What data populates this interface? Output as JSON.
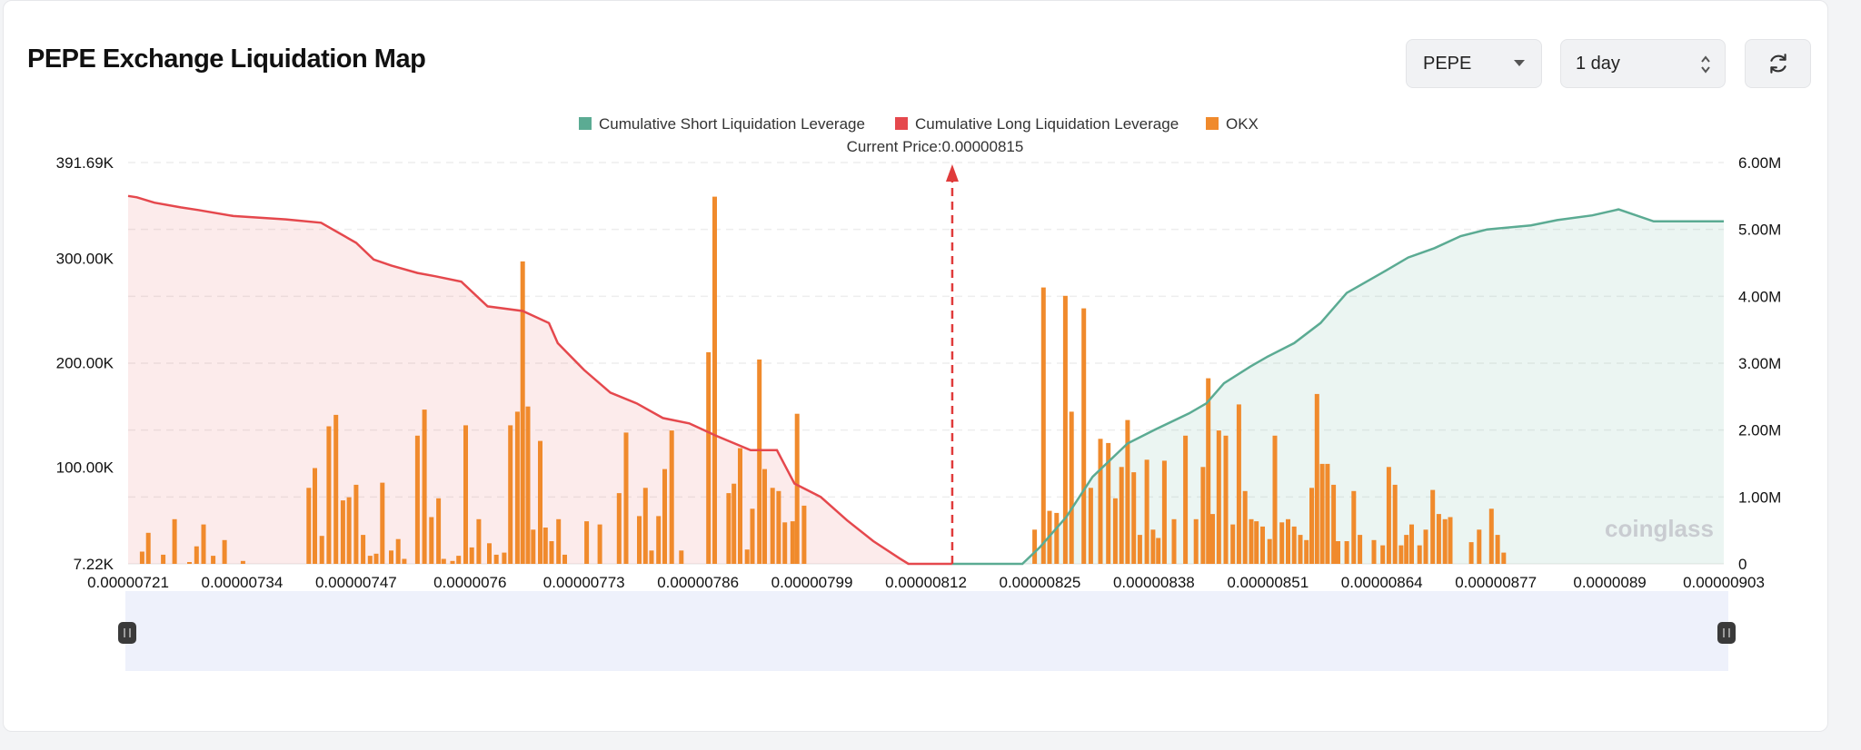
{
  "title": "PEPE Exchange Liquidation Map",
  "controls": {
    "coin": "PEPE",
    "range": "1 day"
  },
  "icons": {
    "dropdown": "caret-down-icon",
    "stepper": "updown-icon",
    "refresh": "refresh-icon"
  },
  "watermark": "coinglass",
  "colors": {
    "short": "#5bab93",
    "long": "#e5484d",
    "okx": "#f08a2c"
  },
  "chart_data": {
    "type": "bar",
    "current_price_label": "Current Price:0.00000815",
    "current_price": 8.15e-06,
    "legend": [
      {
        "name": "Cumulative Short Liquidation Leverage",
        "color": "#5bab93"
      },
      {
        "name": "Cumulative Long Liquidation Leverage",
        "color": "#e5484d"
      },
      {
        "name": "OKX",
        "color": "#f08a2c"
      }
    ],
    "x_ticks": [
      "0.00000721",
      "0.00000734",
      "0.00000747",
      "0.0000076",
      "0.00000773",
      "0.00000786",
      "0.00000799",
      "0.00000812",
      "0.00000825",
      "0.00000838",
      "0.00000851",
      "0.00000864",
      "0.00000877",
      "0.0000089",
      "0.00000903"
    ],
    "x_range": [
      7.21e-06,
      9.03e-06
    ],
    "y_left": {
      "ticks": [
        "7.22K",
        "100.00K",
        "200.00K",
        "300.00K",
        "391.69K"
      ],
      "tick_values": [
        7220,
        100000,
        200000,
        300000,
        391690
      ],
      "range": [
        7220,
        391690
      ]
    },
    "y_right": {
      "ticks": [
        "0",
        "1.00M",
        "2.00M",
        "3.00M",
        "4.00M",
        "5.00M",
        "6.00M"
      ],
      "tick_values": [
        0,
        1000000,
        2000000,
        3000000,
        4000000,
        5000000,
        6000000
      ],
      "range": [
        0,
        6000000
      ]
    },
    "okx_bars": [
      [
        7.226e-06,
        19000
      ],
      [
        7.233e-06,
        37000
      ],
      [
        7.25e-06,
        16000
      ],
      [
        7.263e-06,
        50000
      ],
      [
        7.28e-06,
        9000
      ],
      [
        7.288e-06,
        24000
      ],
      [
        7.296e-06,
        45000
      ],
      [
        7.307e-06,
        15000
      ],
      [
        7.32e-06,
        30000
      ],
      [
        7.341e-06,
        10000
      ],
      [
        7.416e-06,
        80000
      ],
      [
        7.423e-06,
        99000
      ],
      [
        7.431e-06,
        34000
      ],
      [
        7.439e-06,
        139000
      ],
      [
        7.447e-06,
        150000
      ],
      [
        7.455e-06,
        68000
      ],
      [
        7.462e-06,
        71000
      ],
      [
        7.47e-06,
        83000
      ],
      [
        7.478e-06,
        35000
      ],
      [
        7.486e-06,
        15000
      ],
      [
        7.493e-06,
        17000
      ],
      [
        7.5e-06,
        85000
      ],
      [
        7.51e-06,
        20000
      ],
      [
        7.518e-06,
        31000
      ],
      [
        7.525e-06,
        12000
      ],
      [
        7.54e-06,
        130000
      ],
      [
        7.548e-06,
        155000
      ],
      [
        7.556e-06,
        52000
      ],
      [
        7.564e-06,
        70000
      ],
      [
        7.57e-06,
        12000
      ],
      [
        7.58e-06,
        10000
      ],
      [
        7.587e-06,
        15000
      ],
      [
        7.595e-06,
        140000
      ],
      [
        7.602e-06,
        23000
      ],
      [
        7.61e-06,
        50000
      ],
      [
        7.622e-06,
        27000
      ],
      [
        7.63e-06,
        16000
      ],
      [
        7.639e-06,
        18000
      ],
      [
        7.646e-06,
        140000
      ],
      [
        7.654e-06,
        153000
      ],
      [
        7.66e-06,
        297000
      ],
      [
        7.666e-06,
        158000
      ],
      [
        7.672e-06,
        40000
      ],
      [
        7.68e-06,
        125000
      ],
      [
        7.686e-06,
        42000
      ],
      [
        7.693e-06,
        29000
      ],
      [
        7.701e-06,
        50000
      ],
      [
        7.708e-06,
        16000
      ],
      [
        7.733e-06,
        48000
      ],
      [
        7.748e-06,
        45000
      ],
      [
        7.77e-06,
        75000
      ],
      [
        7.778e-06,
        133000
      ],
      [
        7.793e-06,
        53000
      ],
      [
        7.8e-06,
        80000
      ],
      [
        7.807e-06,
        20000
      ],
      [
        7.815e-06,
        53000
      ],
      [
        7.822e-06,
        98000
      ],
      [
        7.83e-06,
        135000
      ],
      [
        7.841e-06,
        20000
      ],
      [
        7.872e-06,
        210000
      ],
      [
        7.879e-06,
        359000
      ],
      [
        7.895e-06,
        75000
      ],
      [
        7.901e-06,
        84000
      ],
      [
        7.908e-06,
        118000
      ],
      [
        7.916e-06,
        21000
      ],
      [
        7.922e-06,
        60000
      ],
      [
        7.93e-06,
        203000
      ],
      [
        7.936e-06,
        98000
      ],
      [
        7.945e-06,
        80000
      ],
      [
        7.952e-06,
        77000
      ],
      [
        7.959e-06,
        47000
      ],
      [
        7.968e-06,
        48000
      ],
      [
        7.973e-06,
        151000
      ],
      [
        7.981e-06,
        63000
      ],
      [
        8.244e-06,
        40000
      ],
      [
        8.254e-06,
        272000
      ],
      [
        8.261e-06,
        58000
      ],
      [
        8.269e-06,
        56000
      ],
      [
        8.279e-06,
        264000
      ],
      [
        8.286e-06,
        153000
      ],
      [
        8.3e-06,
        252000
      ],
      [
        8.308e-06,
        80000
      ],
      [
        8.319e-06,
        127000
      ],
      [
        8.328e-06,
        123000
      ],
      [
        8.336e-06,
        70000
      ],
      [
        8.343e-06,
        100000
      ],
      [
        8.35e-06,
        145000
      ],
      [
        8.357e-06,
        95000
      ],
      [
        8.364e-06,
        35000
      ],
      [
        8.372e-06,
        107000
      ],
      [
        8.379e-06,
        40000
      ],
      [
        8.385e-06,
        32000
      ],
      [
        8.392e-06,
        106000
      ],
      [
        8.403e-06,
        50000
      ],
      [
        8.416e-06,
        130000
      ],
      [
        8.428e-06,
        50000
      ],
      [
        8.436e-06,
        100000
      ],
      [
        8.442e-06,
        185000
      ],
      [
        8.447e-06,
        55000
      ],
      [
        8.454e-06,
        135000
      ],
      [
        8.462e-06,
        130000
      ],
      [
        8.47e-06,
        45000
      ],
      [
        8.477e-06,
        160000
      ],
      [
        8.484e-06,
        77000
      ],
      [
        8.491e-06,
        50000
      ],
      [
        8.497e-06,
        48000
      ],
      [
        8.504e-06,
        43000
      ],
      [
        8.512e-06,
        31000
      ],
      [
        8.518e-06,
        130000
      ],
      [
        8.526e-06,
        47000
      ],
      [
        8.533e-06,
        50000
      ],
      [
        8.54e-06,
        43000
      ],
      [
        8.547e-06,
        35000
      ],
      [
        8.554e-06,
        30000
      ],
      [
        8.56e-06,
        80000
      ],
      [
        8.566e-06,
        170000
      ],
      [
        8.572e-06,
        103000
      ],
      [
        8.578e-06,
        103000
      ],
      [
        8.585e-06,
        83000
      ],
      [
        8.59e-06,
        29000
      ],
      [
        8.6e-06,
        29000
      ],
      [
        8.608e-06,
        77000
      ],
      [
        8.615e-06,
        35000
      ],
      [
        8.631e-06,
        30000
      ],
      [
        8.641e-06,
        25000
      ],
      [
        8.648e-06,
        100000
      ],
      [
        8.655e-06,
        83000
      ],
      [
        8.662e-06,
        25000
      ],
      [
        8.668e-06,
        35000
      ],
      [
        8.674e-06,
        45000
      ],
      [
        8.683e-06,
        25000
      ],
      [
        8.69e-06,
        40000
      ],
      [
        8.698e-06,
        78000
      ],
      [
        8.705e-06,
        55000
      ],
      [
        8.712e-06,
        50000
      ],
      [
        8.718e-06,
        52000
      ],
      [
        8.742e-06,
        28000
      ],
      [
        8.751e-06,
        40000
      ],
      [
        8.765e-06,
        60000
      ],
      [
        8.772e-06,
        35000
      ],
      [
        8.779e-06,
        18000
      ]
    ],
    "long_cumulative": [
      [
        7.21e-06,
        5500000
      ],
      [
        7.22e-06,
        5480000
      ],
      [
        7.24e-06,
        5400000
      ],
      [
        7.27e-06,
        5330000
      ],
      [
        7.29e-06,
        5290000
      ],
      [
        7.33e-06,
        5200000
      ],
      [
        7.39e-06,
        5150000
      ],
      [
        7.43e-06,
        5100000
      ],
      [
        7.47e-06,
        4800000
      ],
      [
        7.49e-06,
        4550000
      ],
      [
        7.51e-06,
        4460000
      ],
      [
        7.54e-06,
        4350000
      ],
      [
        7.56e-06,
        4300000
      ],
      [
        7.59e-06,
        4220000
      ],
      [
        7.62e-06,
        3850000
      ],
      [
        7.66e-06,
        3780000
      ],
      [
        7.69e-06,
        3600000
      ],
      [
        7.7e-06,
        3300000
      ],
      [
        7.73e-06,
        2900000
      ],
      [
        7.76e-06,
        2560000
      ],
      [
        7.79e-06,
        2400000
      ],
      [
        7.82e-06,
        2180000
      ],
      [
        7.85e-06,
        2100000
      ],
      [
        7.88e-06,
        1920000
      ],
      [
        7.92e-06,
        1700000
      ],
      [
        7.95e-06,
        1700000
      ],
      [
        7.97e-06,
        1200000
      ],
      [
        8e-06,
        1000000
      ],
      [
        8.03e-06,
        650000
      ],
      [
        8.06e-06,
        340000
      ],
      [
        8.09e-06,
        80000
      ],
      [
        8.1e-06,
        0
      ],
      [
        8.15e-06,
        0
      ]
    ],
    "short_cumulative": [
      [
        8.15e-06,
        0
      ],
      [
        8.23e-06,
        0
      ],
      [
        8.25e-06,
        250000
      ],
      [
        8.28e-06,
        700000
      ],
      [
        8.31e-06,
        1300000
      ],
      [
        8.35e-06,
        1800000
      ],
      [
        8.38e-06,
        2000000
      ],
      [
        8.42e-06,
        2250000
      ],
      [
        8.44e-06,
        2400000
      ],
      [
        8.46e-06,
        2700000
      ],
      [
        8.49e-06,
        2950000
      ],
      [
        8.51e-06,
        3100000
      ],
      [
        8.54e-06,
        3300000
      ],
      [
        8.57e-06,
        3600000
      ],
      [
        8.6e-06,
        4050000
      ],
      [
        8.64e-06,
        4350000
      ],
      [
        8.67e-06,
        4580000
      ],
      [
        8.7e-06,
        4720000
      ],
      [
        8.73e-06,
        4900000
      ],
      [
        8.76e-06,
        5000000
      ],
      [
        8.81e-06,
        5060000
      ],
      [
        8.84e-06,
        5140000
      ],
      [
        8.88e-06,
        5210000
      ],
      [
        8.91e-06,
        5300000
      ],
      [
        8.95e-06,
        5120000
      ],
      [
        9.03e-06,
        5120000
      ]
    ]
  }
}
